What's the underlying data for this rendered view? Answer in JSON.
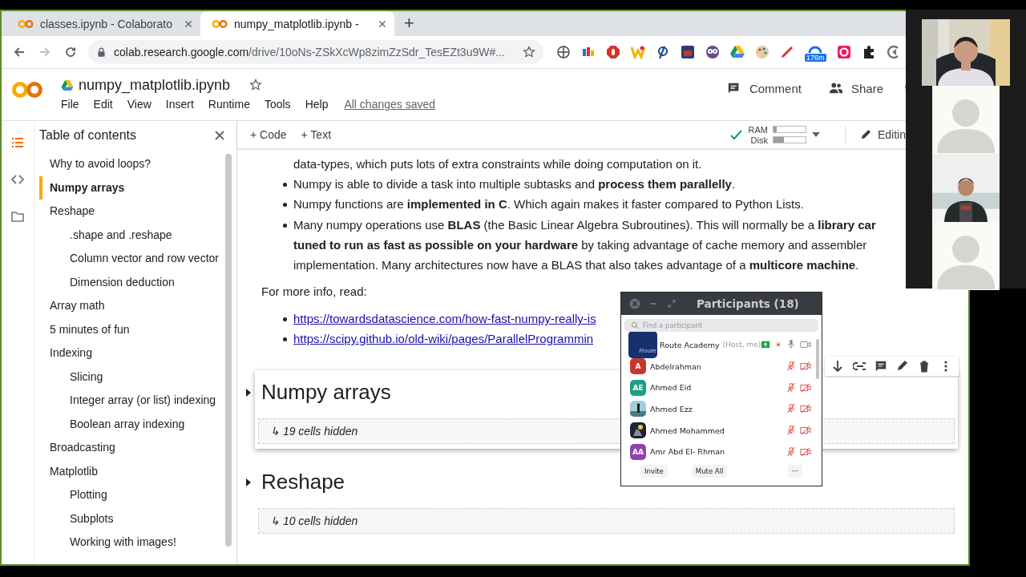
{
  "browser": {
    "tabs": [
      {
        "title": "classes.ipynb - Colaborato",
        "selected": false
      },
      {
        "title": "numpy_matplotlib.ipynb -",
        "selected": true
      }
    ],
    "new_tab": "+",
    "address": {
      "host": "colab.research.google.com",
      "path": "/drive/10oNs-ZSkXcWp8zimZzSdr_TesEZt3u9W#..."
    },
    "extension_badge": "176m"
  },
  "notebook": {
    "title": "numpy_matplotlib.ipynb",
    "menu": [
      "File",
      "Edit",
      "View",
      "Insert",
      "Runtime",
      "Tools",
      "Help"
    ],
    "save_status": "All changes saved",
    "header_buttons": [
      "Comment",
      "Share"
    ]
  },
  "toolbar": {
    "add_buttons": [
      "+ Code",
      "+ Text"
    ],
    "ram": {
      "label": "RAM",
      "level": 0.1
    },
    "disk": {
      "label": "Disk",
      "level": 0.32
    },
    "mode": "Editin"
  },
  "sidebar": {
    "title": "Table of contents",
    "rail": [
      {
        "kind": "toc",
        "selected": true
      },
      {
        "kind": "code",
        "selected": false
      },
      {
        "kind": "files",
        "selected": false
      }
    ],
    "items": [
      {
        "label": "Why to avoid loops?",
        "selected": false
      },
      {
        "label": "Numpy arrays",
        "selected": true
      },
      {
        "label": "Reshape",
        "selected": false,
        "children": [
          {
            "label": ".shape and .reshape",
            "selected": false
          },
          {
            "label": "Column vector and row vector",
            "selected": false
          },
          {
            "label": "Dimension deduction",
            "selected": false
          }
        ]
      },
      {
        "label": "Array math",
        "selected": false
      },
      {
        "label": "5 minutes of fun",
        "selected": false
      },
      {
        "label": "Indexing",
        "selected": false,
        "children": [
          {
            "label": "Slicing",
            "selected": false
          },
          {
            "label": "Integer array (or list) indexing",
            "selected": false
          },
          {
            "label": "Boolean array indexing",
            "selected": false
          }
        ]
      },
      {
        "label": "Broadcasting",
        "selected": false
      },
      {
        "label": "Matplotlib",
        "selected": false,
        "children": [
          {
            "label": "Plotting",
            "selected": false
          },
          {
            "label": "Subplots",
            "selected": false
          },
          {
            "label": "Working with images!",
            "selected": false
          }
        ]
      }
    ]
  },
  "content": {
    "bullets": [
      {
        "kind": "continuation",
        "lines": [
          "data-types, which puts lots of extra constraints while doing computation on it."
        ]
      },
      {
        "kind": "bullet",
        "lines": [
          "Numpy is able to divide a task into multiple subtasks and **process them parallelly**."
        ]
      },
      {
        "kind": "bullet",
        "lines": [
          "Numpy functions are **implemented in C**. Which again makes it faster compared to Python Lists."
        ]
      },
      {
        "kind": "bullet",
        "lines": [
          "Many numpy operations use **BLAS** (the Basic Linear Algebra Subroutines). This will normally be a **library car**",
          "**tuned to run as fast as possible on your hardware** by taking advantage of cache memory and assembler",
          "implementation. Many architectures now have a BLAS that also takes advantage of a **multicore machine**."
        ]
      }
    ],
    "more_info": "For more info, read:",
    "links": [
      "https://towardsdatascience.com/how-fast-numpy-really-is",
      "https://scipy.github.io/old-wiki/pages/ParallelProgrammin"
    ],
    "sections": [
      {
        "title": "Numpy arrays",
        "hidden": "↳ 19 cells hidden",
        "selected": true
      },
      {
        "title": "Reshape",
        "hidden": "↳ 10 cells hidden",
        "selected": false
      }
    ]
  },
  "participants": {
    "title": "Participants (18)",
    "search_placeholder": "Find a participant",
    "people": [
      {
        "name": "Route Academy",
        "role": "(Host, me)",
        "kind": "logo",
        "avatar_text": "Route",
        "color": "#17306e",
        "host": true,
        "muted": false,
        "video_on": true
      },
      {
        "name": "Abdelrahman",
        "kind": "initials",
        "avatar_text": "A",
        "color": "#c9372c",
        "host": false,
        "muted": true,
        "video_on": false
      },
      {
        "name": "Ahmed Eid",
        "kind": "initials",
        "avatar_text": "AE",
        "color": "#1e9e85",
        "host": false,
        "muted": true,
        "video_on": false
      },
      {
        "name": "Ahmed Ezz",
        "kind": "picture",
        "host": false,
        "muted": true,
        "video_on": false
      },
      {
        "name": "Ahmed Mohammed",
        "kind": "picture",
        "host": false,
        "muted": true,
        "video_on": false
      },
      {
        "name": "Amr Abd El- Rhman",
        "kind": "initials",
        "avatar_text": "AA",
        "color": "#8e44ad",
        "host": false,
        "muted": true,
        "video_on": false
      }
    ],
    "buttons": [
      "Invite",
      "Mute All",
      "···"
    ]
  },
  "video_tiles": [
    {
      "kind": "picture"
    },
    {
      "kind": "avatar"
    },
    {
      "kind": "picture"
    },
    {
      "kind": "avatar"
    }
  ]
}
